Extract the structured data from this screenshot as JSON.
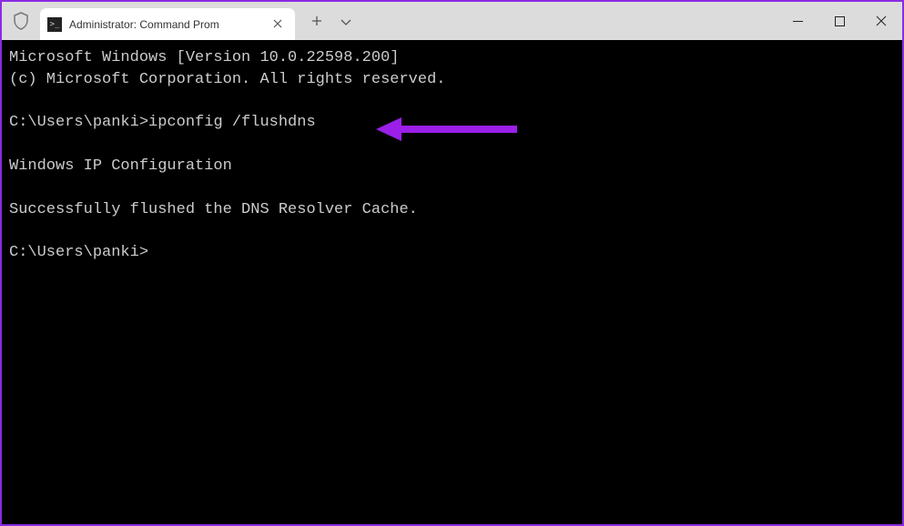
{
  "titlebar": {
    "tab_title": "Administrator: Command Prom",
    "tab_icon_text": ">_"
  },
  "terminal": {
    "line1": "Microsoft Windows [Version 10.0.22598.200]",
    "line2": "(c) Microsoft Corporation. All rights reserved.",
    "prompt1": "C:\\Users\\panki>",
    "command1": "ipconfig /flushdns",
    "output_header": "Windows IP Configuration",
    "output_msg": "Successfully flushed the DNS Resolver Cache.",
    "prompt2": "C:\\Users\\panki>"
  },
  "annotation": {
    "arrow_color": "#9b1fe8"
  }
}
